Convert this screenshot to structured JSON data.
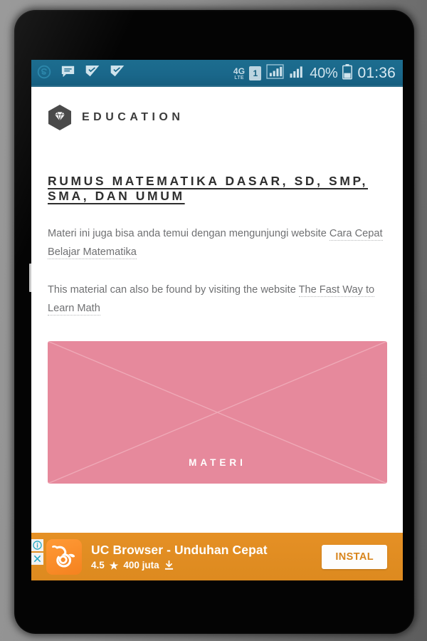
{
  "status_bar": {
    "icons_left": [
      "skype-icon",
      "chat-bubble-icon",
      "flag-check-icon",
      "flag-check-icon"
    ],
    "network_type": "4G",
    "network_sub": "LTE",
    "sim_label": "1",
    "signal_icons": [
      "signal-bars-boxed-icon",
      "signal-bars-icon"
    ],
    "battery_percent": "40%",
    "battery_icon": "battery-icon",
    "clock": "01:36",
    "bg_color": "#1a678a"
  },
  "brand": {
    "logo_icon": "hexagon-diamond-icon",
    "name": "EDUCATION"
  },
  "article": {
    "title": "RUMUS MATEMATIKA DASAR, SD, SMP, SMA, DAN UMUM",
    "paragraph_id_prefix": "Materi ini juga bisa anda temui dengan mengunjungi website ",
    "paragraph_id_link": "Cara Cepat Belajar Matematika",
    "paragraph_en_prefix": "This material can also be found by visiting the website ",
    "paragraph_en_link": "The Fast Way to Learn Math"
  },
  "media": {
    "label": "MATERI",
    "bg_color": "#e6899c",
    "placeholder_icon": "image-placeholder-cross"
  },
  "ad": {
    "info_icon": "info-icon",
    "close_icon": "close-icon",
    "app_icon": "uc-browser-squirrel-icon",
    "title": "UC Browser - Unduhan Cepat",
    "rating": "4.5",
    "star_icon": "star-icon",
    "downloads": "400 juta",
    "download_icon": "download-icon",
    "cta_label": "INSTAL",
    "bg_color": "#e0891f"
  }
}
